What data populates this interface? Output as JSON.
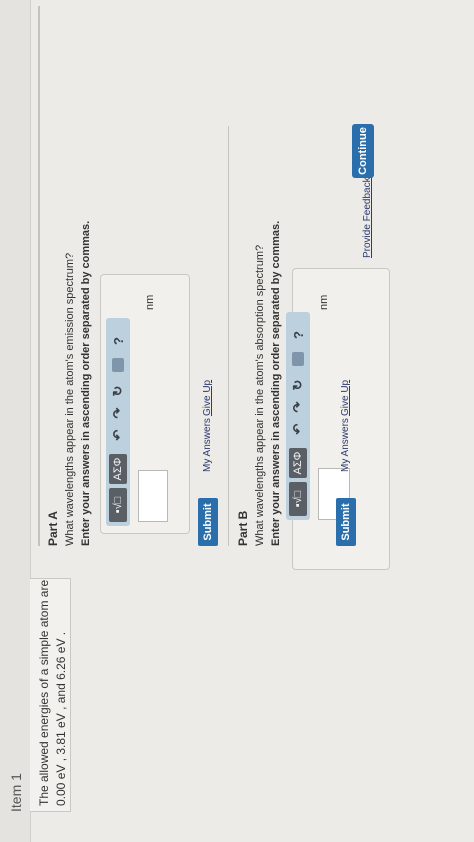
{
  "item": {
    "title": "Item 1"
  },
  "problem": {
    "text": "The allowed energies of a simple atom are 0.00 eV , 3.81 eV , and 6.26 eV ."
  },
  "partA": {
    "title": "Part A",
    "question": "What wavelengths appear in the atom's emission spectrum?",
    "instruction": "Enter your answers in ascending order separated by commas.",
    "toolbar": {
      "templates_label": "▪√□",
      "greek_label": "ΑΣΦ",
      "undo": "↶",
      "redo": "↷",
      "reset": "↻",
      "help": "?"
    },
    "input_value": "",
    "unit": "nm",
    "submit_label": "Submit",
    "my_answers_label": "My Answers",
    "give_up_label": "Give Up"
  },
  "partB": {
    "title": "Part B",
    "question": "What wavelengths appear in the atom's absorption spectrum?",
    "instruction": "Enter your answers in ascending order separated by commas.",
    "toolbar": {
      "templates_label": "▪√□",
      "greek_label": "ΑΣΦ",
      "undo": "↶",
      "redo": "↷",
      "reset": "↻",
      "help": "?"
    },
    "input_value": "",
    "unit": "nm",
    "submit_label": "Submit",
    "my_answers_label": "My Answers",
    "give_up_label": "Give Up"
  },
  "footer": {
    "feedback_label": "Provide Feedback",
    "continue_label": "Continue"
  }
}
